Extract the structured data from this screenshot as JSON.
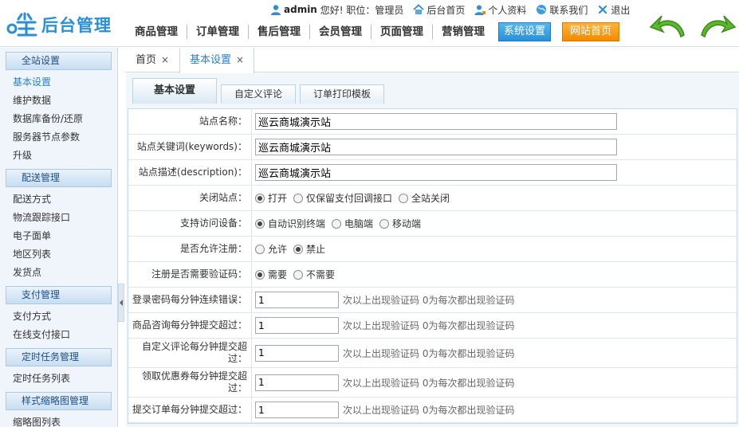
{
  "app": {
    "logo_text": "后台管理"
  },
  "topbar": {
    "user": "admin",
    "greeting": "您好!",
    "role_label": "职位：",
    "role": "管理员",
    "links": [
      "后台首页",
      "个人资料",
      "联系我们",
      "退出"
    ]
  },
  "nav": {
    "items": [
      "商品管理",
      "订单管理",
      "售后管理",
      "会员管理",
      "页面管理",
      "营销管理"
    ],
    "active": "系统设置",
    "home": "网站首页"
  },
  "sidebar": {
    "groups": [
      {
        "title": "全站设置",
        "items": [
          "基本设置",
          "维护数据",
          "数据库备份/还原",
          "服务器节点参数",
          "升级"
        ]
      },
      {
        "title": "配送管理",
        "items": [
          "配送方式",
          "物流跟踪接口",
          "电子面单",
          "地区列表",
          "发货点"
        ]
      },
      {
        "title": "支付管理",
        "items": [
          "支付方式",
          "在线支付接口"
        ]
      },
      {
        "title": "定时任务管理",
        "items": [
          "定时任务列表"
        ]
      },
      {
        "title": "样式缩略图管理",
        "items": [
          "缩略图列表"
        ]
      }
    ]
  },
  "page_tabs": {
    "home": "首页",
    "current": "基本设置",
    "close": "×"
  },
  "subtabs": [
    "基本设置",
    "自定义评论",
    "订单打印模板"
  ],
  "form": {
    "site_name": {
      "label": "站点名称：",
      "value": "巡云商城演示站"
    },
    "keywords": {
      "label": "站点关键词(keywords)：",
      "value": "巡云商城演示站"
    },
    "description": {
      "label": "站点描述(description)：",
      "value": "巡云商城演示站"
    },
    "close_site": {
      "label": "关闭站点：",
      "options": [
        "打开",
        "仅保留支付回调接口",
        "全站关闭"
      ]
    },
    "devices": {
      "label": "支持访问设备：",
      "options": [
        "自动识别终端",
        "电脑端",
        "移动端"
      ]
    },
    "allow_register": {
      "label": "是否允许注册：",
      "options": [
        "允许",
        "禁止"
      ]
    },
    "register_captcha": {
      "label": "注册是否需要验证码：",
      "options": [
        "需要",
        "不需要"
      ]
    },
    "login_errors": {
      "label": "登录密码每分钟连续错误：",
      "value": "1",
      "hint": "次以上出现验证码 0为每次都出现验证码"
    },
    "product_inquiry": {
      "label": "商品咨询每分钟提交超过：",
      "value": "1",
      "hint": "次以上出现验证码 0为每次都出现验证码"
    },
    "custom_comment": {
      "label_line1": "自定义评论每分钟提交超",
      "label_line2": "过：",
      "value": "1",
      "hint": "次以上出现验证码 0为每次都出现验证码"
    },
    "coupon": {
      "label_line1": "领取优惠券每分钟提交超",
      "label_line2": "过：",
      "value": "1",
      "hint": "次以上出现验证码 0为每次都出现验证码"
    },
    "order_submit": {
      "label": "提交订单每分钟提交超过：",
      "value": "1",
      "hint": "次以上出现验证码 0为每次都出现验证码"
    }
  }
}
